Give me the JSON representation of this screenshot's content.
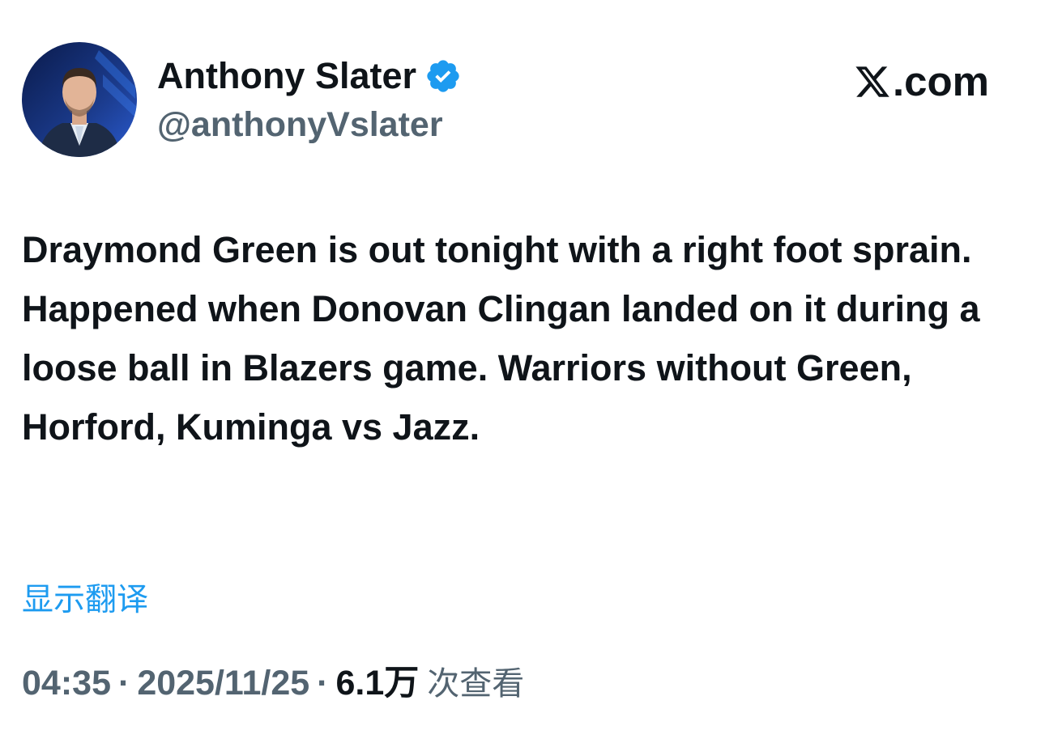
{
  "author": {
    "display_name": "Anthony Slater",
    "handle": "@anthonyVslater",
    "verified": true,
    "avatar_icon": "profile-photo"
  },
  "brand": {
    "logo_icon": "x-logo-icon",
    "text": ".com"
  },
  "tweet": {
    "text": "Draymond Green is out tonight with a right foot sprain. Happened when Donovan Clingan landed on it during a loose ball in Blazers game. Warriors without Green, Horford, Kuminga vs Jazz."
  },
  "translate_label": "显示翻译",
  "meta": {
    "time": "04:35",
    "separator": "·",
    "date": "2025/11/25",
    "views_count": "6.1万",
    "views_label": "次查看"
  },
  "colors": {
    "text": "#0f1419",
    "secondary": "#536471",
    "link": "#1d9bf0",
    "verified": "#1d9bf0"
  }
}
